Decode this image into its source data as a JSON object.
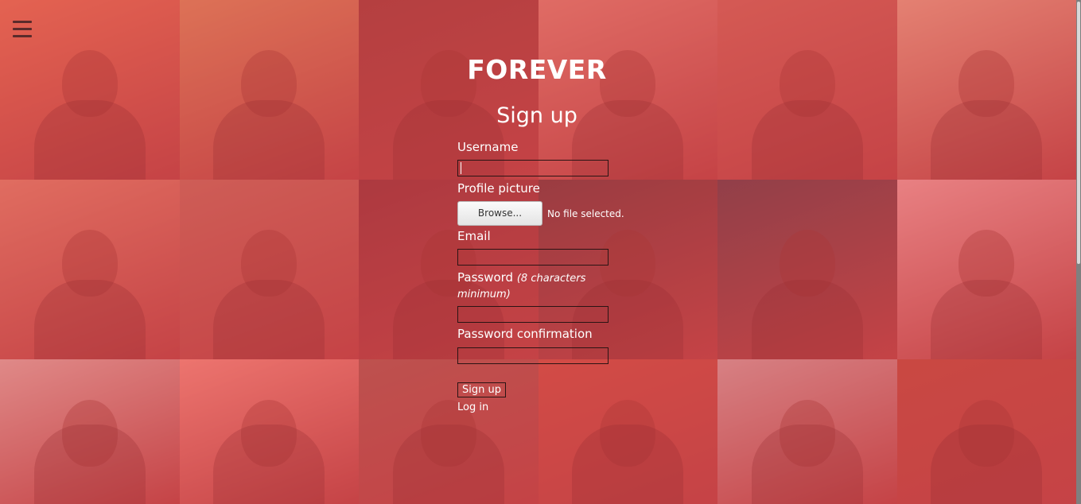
{
  "app": {
    "brand": "FOREVER"
  },
  "form": {
    "heading": "Sign up",
    "username_label": "Username",
    "username_value": "",
    "picture_label": "Profile picture",
    "browse_label": "Browse...",
    "file_status": "No file selected.",
    "email_label": "Email",
    "email_value": "",
    "password_label": "Password",
    "password_hint": "(8 characters minimum)",
    "password_value": "",
    "confirm_label": "Password confirmation",
    "confirm_value": "",
    "submit_label": "Sign up",
    "login_link": "Log in"
  },
  "icons": {
    "menu": "hamburger-menu-icon"
  },
  "colors": {
    "overlay": "#e8484e",
    "text": "#ffffff",
    "menu_icon": "#5a2b2b"
  },
  "mosaic": {
    "tiles": [
      {
        "color": "#e07a55"
      },
      {
        "color": "#d3955e"
      },
      {
        "color": "#8a3a36"
      },
      {
        "color": "#d88a78"
      },
      {
        "color": "#c46a5a"
      },
      {
        "color": "#e0b090"
      },
      {
        "color": "#d98c70"
      },
      {
        "color": "#b9705e"
      },
      {
        "color": "#7c2f35"
      },
      {
        "color": "#5a3438"
      },
      {
        "color": "#4a3a45"
      },
      {
        "color": "#e8b0ae"
      },
      {
        "color": "#d8c0b8"
      },
      {
        "color": "#f09a8a"
      },
      {
        "color": "#9a5a50"
      },
      {
        "color": "#c05040"
      },
      {
        "color": "#c8b0b0"
      },
      {
        "color": "#b04a3a"
      }
    ]
  }
}
